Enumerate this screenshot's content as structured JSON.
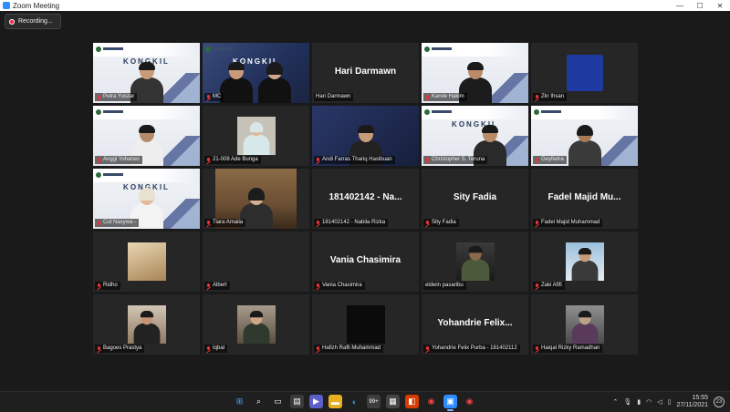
{
  "window": {
    "title": "Zoom Meeting",
    "minimize": "—",
    "maximize": "☐",
    "close": "✕"
  },
  "recording": {
    "label": "Recording..."
  },
  "kongkil": "KONGKIL",
  "tiles": [
    {
      "label": "Putra Yuszar",
      "center": ""
    },
    {
      "label": "MC",
      "center": ""
    },
    {
      "label": "Hari Darmawn",
      "center": "Hari Darmawn"
    },
    {
      "label": "Karvie Hakim",
      "center": ""
    },
    {
      "label": "Zkr Ihsan",
      "center": ""
    },
    {
      "label": "Anggi Yohanes",
      "center": ""
    },
    {
      "label": "21-008 Ade Bunga",
      "center": ""
    },
    {
      "label": "Andi Farras Thariq Hasibuan",
      "center": ""
    },
    {
      "label": "Christopher S. Teruna",
      "center": ""
    },
    {
      "label": "Geyfedra",
      "center": ""
    },
    {
      "label": "Cut Nasywa -",
      "center": ""
    },
    {
      "label": "Tiara Amalia",
      "center": ""
    },
    {
      "label": "181402142 - Nabila Rizka",
      "center": "181402142 - Na..."
    },
    {
      "label": "Sity Fadia",
      "center": "Sity Fadia"
    },
    {
      "label": "Fadel Majid Muhammad",
      "center": "Fadel Majid Mu..."
    },
    {
      "label": "Ridho",
      "center": ""
    },
    {
      "label": "Albert",
      "center": ""
    },
    {
      "label": "Vania Chasimira",
      "center": "Vania Chasimira"
    },
    {
      "label": "eldwin pasaribu",
      "center": ""
    },
    {
      "label": "Zaki Afifi",
      "center": ""
    },
    {
      "label": "Bagoes Prastya",
      "center": ""
    },
    {
      "label": "Iqbal",
      "center": ""
    },
    {
      "label": "Hafizh Rafli Muhammad",
      "center": ""
    },
    {
      "label": "Yohandrie Felix Purba - 181402112",
      "center": "Yohandrie Felix..."
    },
    {
      "label": "Haiqal Rizky Ramadhan",
      "center": ""
    }
  ],
  "taskbar": {
    "clock_time": "15:55",
    "clock_date": "27/11/2021",
    "notification_count": "23",
    "badge_99": "99+"
  },
  "colors": {
    "active_speaker": "#c8e63c",
    "muted_mic": "#e33"
  }
}
